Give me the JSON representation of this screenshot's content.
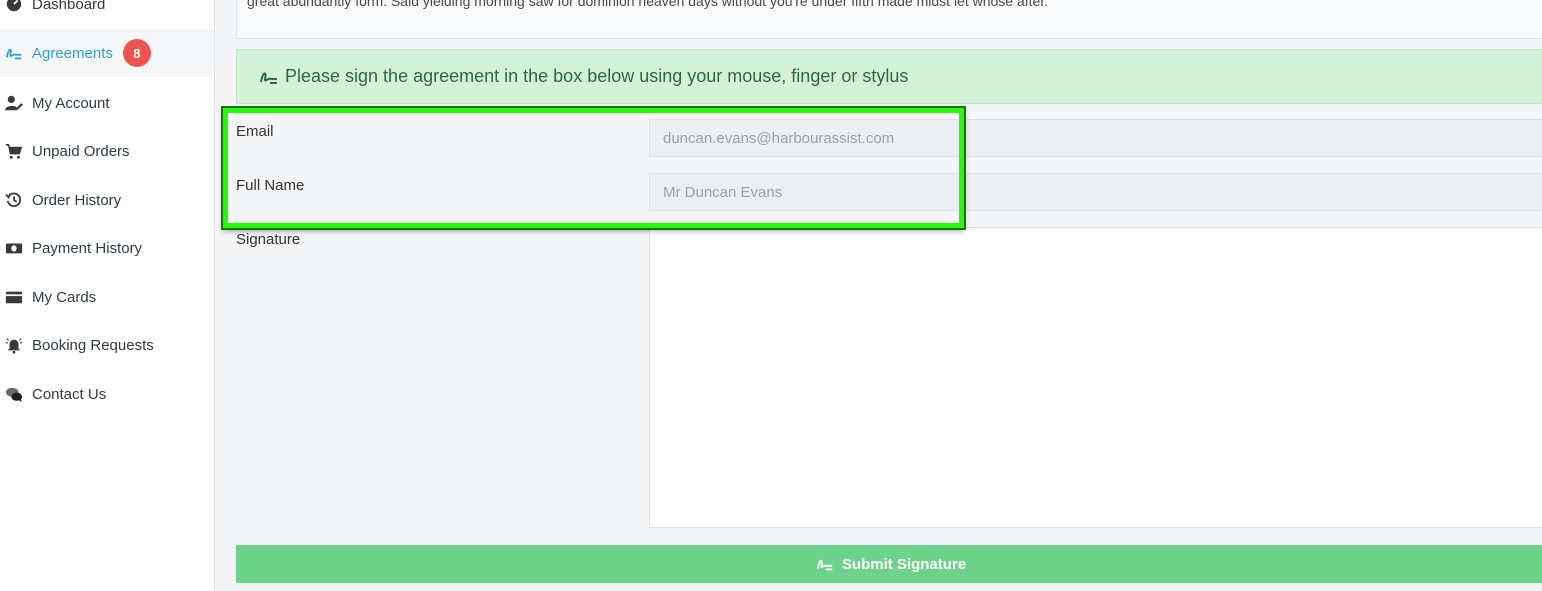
{
  "sidebar": {
    "items": [
      {
        "label": "Dashboard",
        "icon": "dashboard-icon"
      },
      {
        "label": "Agreements",
        "icon": "signature-icon",
        "badge": "8",
        "active": true
      },
      {
        "label": "My Account",
        "icon": "user-edit-icon"
      },
      {
        "label": "Unpaid Orders",
        "icon": "cart-icon"
      },
      {
        "label": "Order History",
        "icon": "history-icon"
      },
      {
        "label": "Payment History",
        "icon": "money-icon"
      },
      {
        "label": "My Cards",
        "icon": "credit-card-icon"
      },
      {
        "label": "Booking Requests",
        "icon": "bell-icon"
      },
      {
        "label": "Contact Us",
        "icon": "chat-icon"
      }
    ]
  },
  "main": {
    "agreement_text_tail": "great abundantly form. Said yielding morning saw for dominion heaven days without you're under fifth made midst let whose after.",
    "sign_prompt": "Please sign the agreement in the box below using your mouse, finger or stylus",
    "form": {
      "email_label": "Email",
      "email_value": "duncan.evans@harbourassist.com",
      "name_label": "Full Name",
      "name_value": "Mr Duncan Evans",
      "signature_label": "Signature"
    },
    "submit_label": "Submit Signature"
  },
  "colors": {
    "accent": "#2ea3c9",
    "badge": "#ef5350",
    "alert_bg": "#d4f1da",
    "submit_bg": "#6dd38a",
    "highlight": "#2bf511"
  }
}
